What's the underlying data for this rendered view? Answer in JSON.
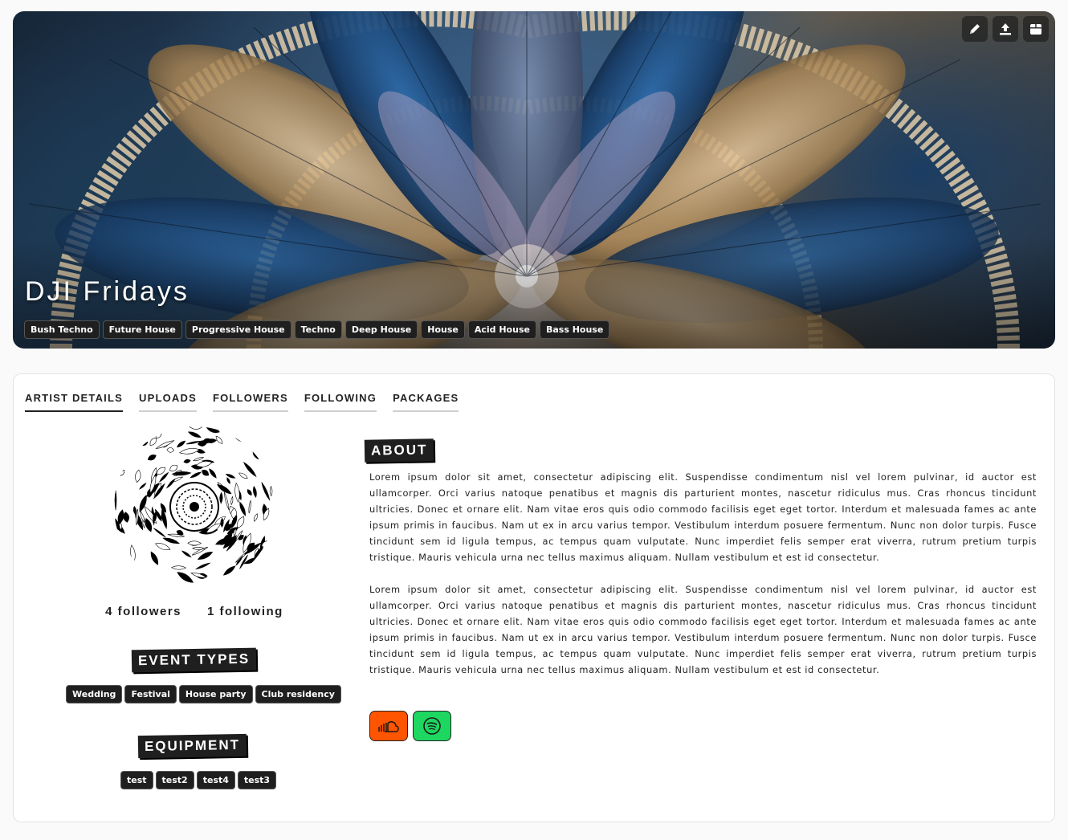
{
  "hero": {
    "title": "DJI Fridays",
    "genres": [
      "Bush Techno",
      "Future House",
      "Progressive House",
      "Techno",
      "Deep House",
      "House",
      "Acid House",
      "Bass House"
    ],
    "tools": [
      "pencil-icon",
      "upload-icon",
      "box-icon"
    ]
  },
  "tabs": [
    "ARTIST DETAILS",
    "UPLOADS",
    "FOLLOWERS",
    "FOLLOWING",
    "PACKAGES"
  ],
  "active_tab": "ARTIST DETAILS",
  "stats": {
    "followers": "4 followers",
    "following": "1 following"
  },
  "event_types": {
    "heading": "EVENT TYPES",
    "items": [
      "Wedding",
      "Festival",
      "House party",
      "Club residency"
    ]
  },
  "equipment": {
    "heading": "EQUIPMENT",
    "items": [
      "test",
      "test2",
      "test4",
      "test3"
    ]
  },
  "about": {
    "heading": "ABOUT",
    "paragraphs": [
      "Lorem ipsum dolor sit amet, consectetur adipiscing elit. Suspendisse condimentum nisl vel lorem pulvinar, id auctor est ullamcorper. Orci varius natoque penatibus et magnis dis parturient montes, nascetur ridiculus mus. Cras rhoncus tincidunt ultricies. Donec et ornare elit. Nam vitae eros quis odio commodo facilisis eget eget tortor. Interdum et malesuada fames ac ante ipsum primis in faucibus. Nam ut ex in arcu varius tempor. Vestibulum interdum posuere fermentum. Nunc non dolor turpis. Fusce tincidunt sem id ligula tempus, ac tempus quam vulputate. Nunc imperdiet felis semper erat viverra, rutrum pretium turpis tristique. Mauris vehicula urna nec tellus maximus aliquam. Nullam vestibulum et est id consectetur.",
      "Lorem ipsum dolor sit amet, consectetur adipiscing elit. Suspendisse condimentum nisl vel lorem pulvinar, id auctor est ullamcorper. Orci varius natoque penatibus et magnis dis parturient montes, nascetur ridiculus mus. Cras rhoncus tincidunt ultricies. Donec et ornare elit. Nam vitae eros quis odio commodo facilisis eget eget tortor. Interdum et malesuada fames ac ante ipsum primis in faucibus. Nam ut ex in arcu varius tempor. Vestibulum interdum posuere fermentum. Nunc non dolor turpis. Fusce tincidunt sem id ligula tempus, ac tempus quam vulputate. Nunc imperdiet felis semper erat viverra, rutrum pretium turpis tristique. Mauris vehicula urna nec tellus maximus aliquam. Nullam vestibulum et est id consectetur."
    ]
  },
  "socials": [
    {
      "icon": "soundcloud-icon",
      "color": "#ff5500"
    },
    {
      "icon": "spotify-icon",
      "color": "#1ed760"
    }
  ]
}
